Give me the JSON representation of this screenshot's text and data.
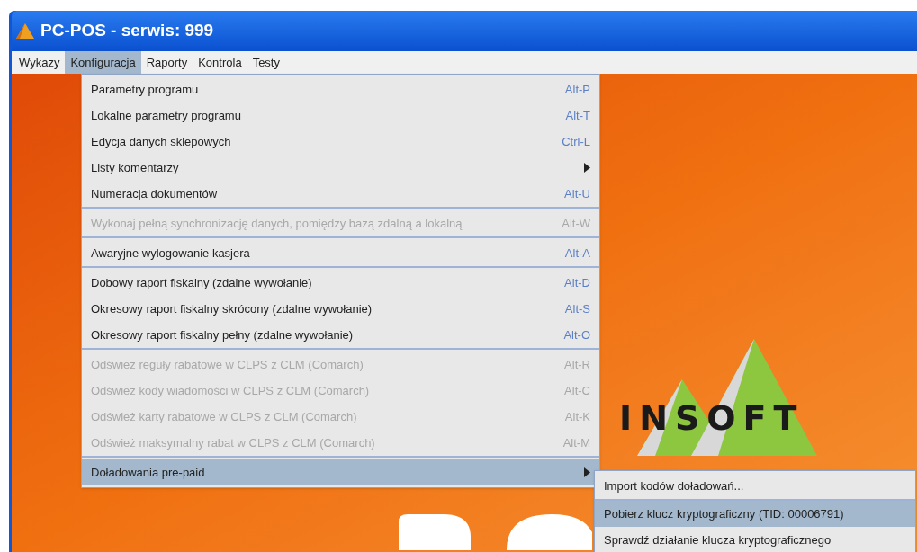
{
  "window": {
    "title": "PC-POS - serwis: 999"
  },
  "menu_bar": [
    {
      "label": "Wykazy",
      "selected": false
    },
    {
      "label": "Konfiguracja",
      "selected": true
    },
    {
      "label": "Raporty",
      "selected": false
    },
    {
      "label": "Kontrola",
      "selected": false
    },
    {
      "label": "Testy",
      "selected": false
    }
  ],
  "dropdown": {
    "groups": [
      [
        {
          "label": "Parametry programu",
          "shortcut": "Alt-P",
          "disabled": false,
          "submenu": false,
          "selected": false
        },
        {
          "label": "Lokalne parametry programu",
          "shortcut": "Alt-T",
          "disabled": false,
          "submenu": false,
          "selected": false
        },
        {
          "label": "Edycja danych sklepowych",
          "shortcut": "Ctrl-L",
          "disabled": false,
          "submenu": false,
          "selected": false
        },
        {
          "label": "Listy komentarzy",
          "disabled": false,
          "submenu": true,
          "selected": false
        },
        {
          "label": "Numeracja dokumentów",
          "shortcut": "Alt-U",
          "disabled": false,
          "submenu": false,
          "selected": false
        }
      ],
      [
        {
          "label": "Wykonaj pełną synchronizację danych, pomiędzy bazą zdalną a lokalną",
          "shortcut": "Alt-W",
          "disabled": true,
          "submenu": false,
          "selected": false
        }
      ],
      [
        {
          "label": "Awaryjne wylogowanie kasjera",
          "shortcut": "Alt-A",
          "disabled": false,
          "submenu": false,
          "selected": false
        }
      ],
      [
        {
          "label": "Dobowy raport fiskalny (zdalne wywołanie)",
          "shortcut": "Alt-D",
          "disabled": false,
          "submenu": false,
          "selected": false
        },
        {
          "label": "Okresowy raport fiskalny skrócony (zdalne wywołanie)",
          "shortcut": "Alt-S",
          "disabled": false,
          "submenu": false,
          "selected": false
        },
        {
          "label": "Okresowy raport fiskalny pełny (zdalne wywołanie)",
          "shortcut": "Alt-O",
          "disabled": false,
          "submenu": false,
          "selected": false
        }
      ],
      [
        {
          "label": "Odśwież reguły rabatowe w CLPS z CLM (Comarch)",
          "shortcut": "Alt-R",
          "disabled": true,
          "submenu": false,
          "selected": false
        },
        {
          "label": "Odśwież kody wiadomości w CLPS z CLM (Comarch)",
          "shortcut": "Alt-C",
          "disabled": true,
          "submenu": false,
          "selected": false
        },
        {
          "label": "Odśwież karty rabatowe w CLPS z CLM (Comarch)",
          "shortcut": "Alt-K",
          "disabled": true,
          "submenu": false,
          "selected": false
        },
        {
          "label": "Odśwież maksymalny rabat w CLPS z CLM (Comarch)",
          "shortcut": "Alt-M",
          "disabled": true,
          "submenu": false,
          "selected": false
        }
      ],
      [
        {
          "label": "Doładowania pre-paid",
          "disabled": false,
          "submenu": true,
          "selected": true
        }
      ]
    ]
  },
  "submenu": {
    "groups": [
      [
        {
          "label": "Import kodów doładowań...",
          "selected": false
        }
      ],
      [
        {
          "label": "Pobierz klucz kryptograficzny (TID: 00006791)",
          "selected": true
        },
        {
          "label": "Sprawdź działanie klucza kryptograficznego",
          "selected": false
        }
      ]
    ]
  },
  "background": {
    "logo_text": "INSOFT"
  }
}
